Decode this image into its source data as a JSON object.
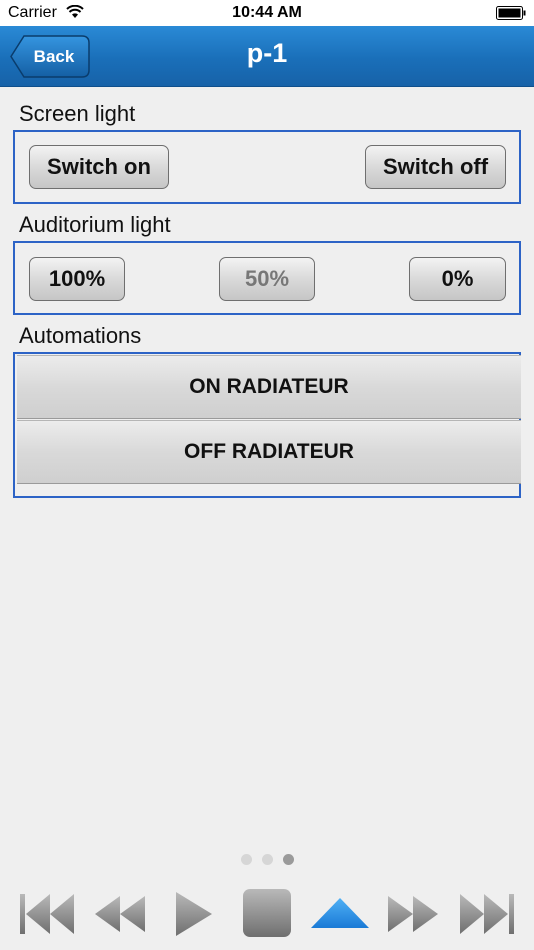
{
  "status_bar": {
    "carrier": "Carrier",
    "time": "10:44 AM"
  },
  "nav": {
    "back_label": "Back",
    "title": "p-1",
    "color": "#1a6fb9"
  },
  "sections": {
    "screen_light": {
      "label": "Screen light",
      "switch_on": "Switch on",
      "switch_off": "Switch off"
    },
    "auditorium_light": {
      "label": "Auditorium light",
      "level_100": "100%",
      "level_50": "50%",
      "level_0": "0%"
    },
    "automations": {
      "label": "Automations",
      "on_radiateur": "ON RADIATEUR",
      "off_radiateur": "OFF RADIATEUR"
    }
  },
  "pager": {
    "total": 3,
    "active_index": 2
  },
  "media_controls": {
    "icons": [
      "skip-back-icon",
      "rewind-icon",
      "play-icon",
      "stop-icon",
      "up-arrow-icon",
      "fast-forward-icon",
      "skip-forward-icon"
    ],
    "accent": "#2a8fe6"
  }
}
